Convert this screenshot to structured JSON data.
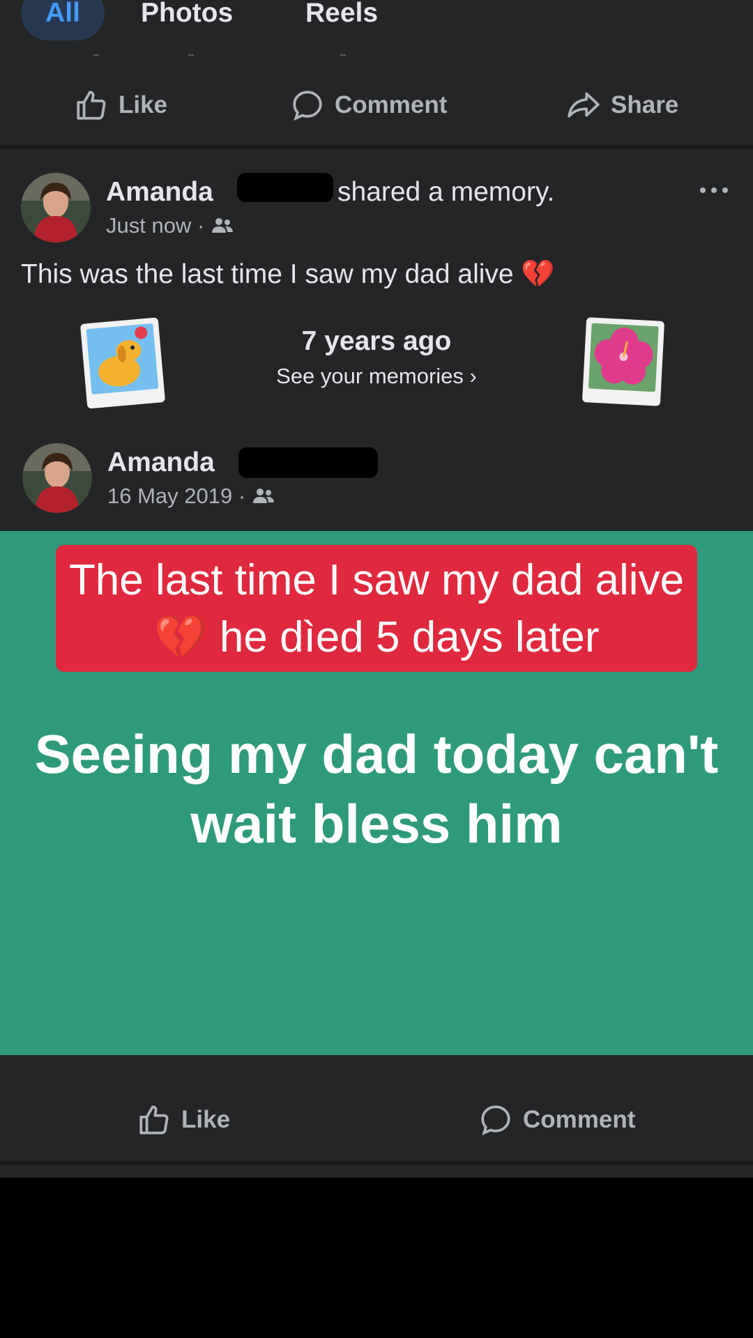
{
  "tabs": [
    {
      "label": "All",
      "active": true
    },
    {
      "label": "Photos",
      "active": false
    },
    {
      "label": "Reels",
      "active": false
    }
  ],
  "top_actions": {
    "like": "Like",
    "comment": "Comment",
    "share": "Share"
  },
  "memory": {
    "author": "Amanda",
    "shared_text": "shared a memory.",
    "time": "Just now ·",
    "caption": "This was the last time I saw my dad alive 💔",
    "years_ago": "7 years ago",
    "see_memories": "See your memories ›"
  },
  "original_post": {
    "author": "Amanda",
    "date": "16 May 2019 ·",
    "overlay_text": "The last time I saw my dad alive 💔 he dìed 5 days later",
    "post_text": "Seeing my dad today can't wait bless him",
    "background_color": "#2f9a7b"
  },
  "bottom_actions": {
    "like": "Like",
    "comment": "Comment"
  },
  "colors": {
    "background": "#242526",
    "accent": "#4599ff",
    "overlay_red": "#e0293f"
  }
}
